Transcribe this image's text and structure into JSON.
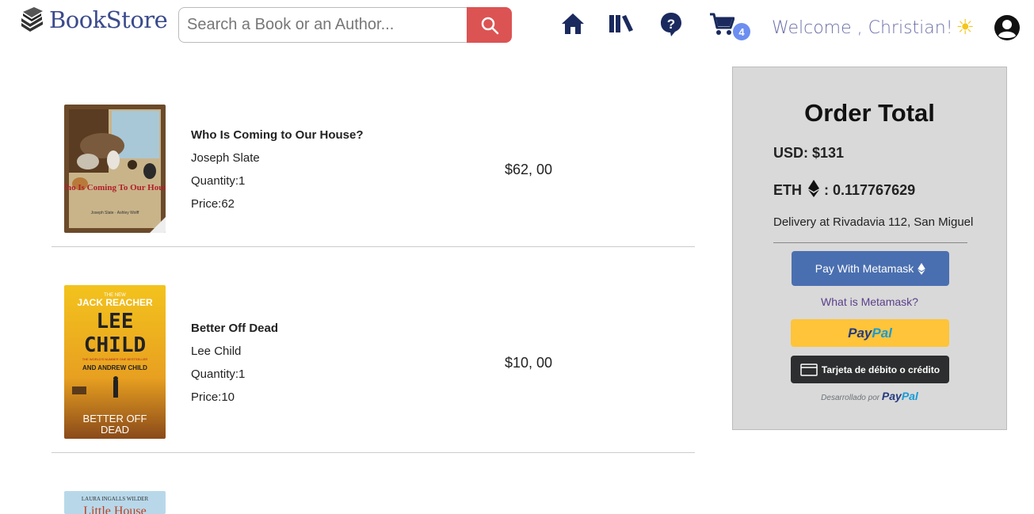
{
  "header": {
    "logo_text": "BookStore",
    "search_placeholder": "Search a Book or an Author...",
    "cart_count": "4",
    "welcome": "Welcome , Christian!"
  },
  "items": [
    {
      "title": "Who Is Coming to Our House?",
      "author": "Joseph Slate",
      "quantity": "Quantity:1",
      "price_line": "Price:62",
      "total": "$62, 00",
      "cover_title": "Who Is Coming To Our House?",
      "cover_byline": "Joseph Slate · Ashley Wolff"
    },
    {
      "title": "Better Off Dead",
      "author": "Lee Child",
      "quantity": "Quantity:1",
      "price_line": "Price:10",
      "total": "$10, 00",
      "cover_top": "THE NEW",
      "cover_series": "JACK REACHER",
      "cover_author1": "LEE",
      "cover_author2": "CHILD",
      "cover_tag": "THE WORLD'S NUMBER ONE BESTSELLER",
      "cover_coauthor": "AND ANDREW CHILD",
      "cover_title1": "BETTER OFF",
      "cover_title2": "DEAD"
    },
    {
      "cover_author": "LAURA INGALLS WILDER",
      "cover_title": "Little House"
    }
  ],
  "order": {
    "title": "Order Total",
    "usd": "USD: $131",
    "eth_label": "ETH",
    "eth_value": ": 0.117767629",
    "delivery": "Delivery at Rivadavia 112, San Miguel",
    "metamask_btn": "Pay With Metamask",
    "what_metamask": "What is Metamask?",
    "paypal_a": "Pay",
    "paypal_b": "Pal",
    "card_btn": "Tarjeta de débito o crédito",
    "powered_by": "Desarrollado por"
  },
  "colors": {
    "brand": "#3a4a8c",
    "search_button": "#dc5353",
    "nav_icons": "#1a2a5e",
    "metamask_button": "#4a6fb0",
    "paypal_yellow": "#ffc439"
  }
}
